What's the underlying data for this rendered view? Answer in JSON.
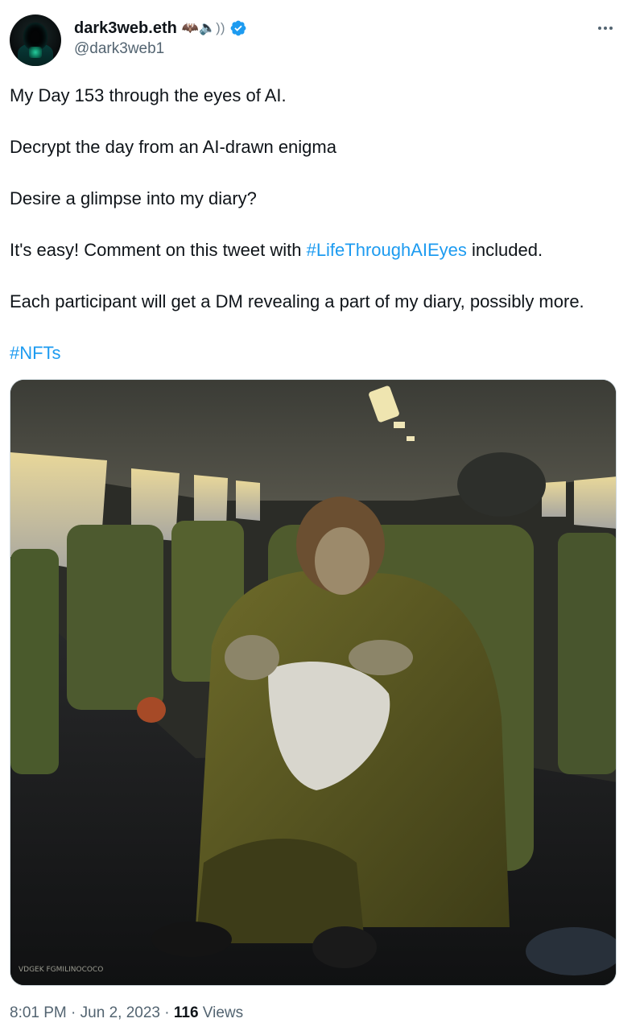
{
  "user": {
    "display_name": "dark3web.eth",
    "emoji": "🦇🔈))",
    "handle": "@dark3web1"
  },
  "tweet": {
    "lines": {
      "l1": "My Day 153 through the eyes of AI.",
      "l2": "Decrypt the day from an AI-drawn enigma",
      "l3": "Desire a glimpse into my diary?",
      "l4_pre": "It's easy! Comment on this tweet with ",
      "l4_tag": "#LifeThroughAIEyes",
      "l4_post": " included.",
      "l5": "Each participant will get a DM revealing a part of my diary, possibly more.",
      "l6_tag": "#NFTs"
    },
    "image_signature": "VDGEK FGMILINOCOCO"
  },
  "meta": {
    "time": "8:01 PM",
    "sep1": " · ",
    "date": "Jun 2, 2023",
    "sep2": " · ",
    "views_count": "116",
    "views_label": " Views"
  },
  "colors": {
    "link": "#1d9bf0",
    "text": "#0f1419",
    "muted": "#536471",
    "verified": "#1d9bf0"
  },
  "icons": {
    "verified": "verified-badge-icon",
    "more": "more-dots-icon"
  }
}
